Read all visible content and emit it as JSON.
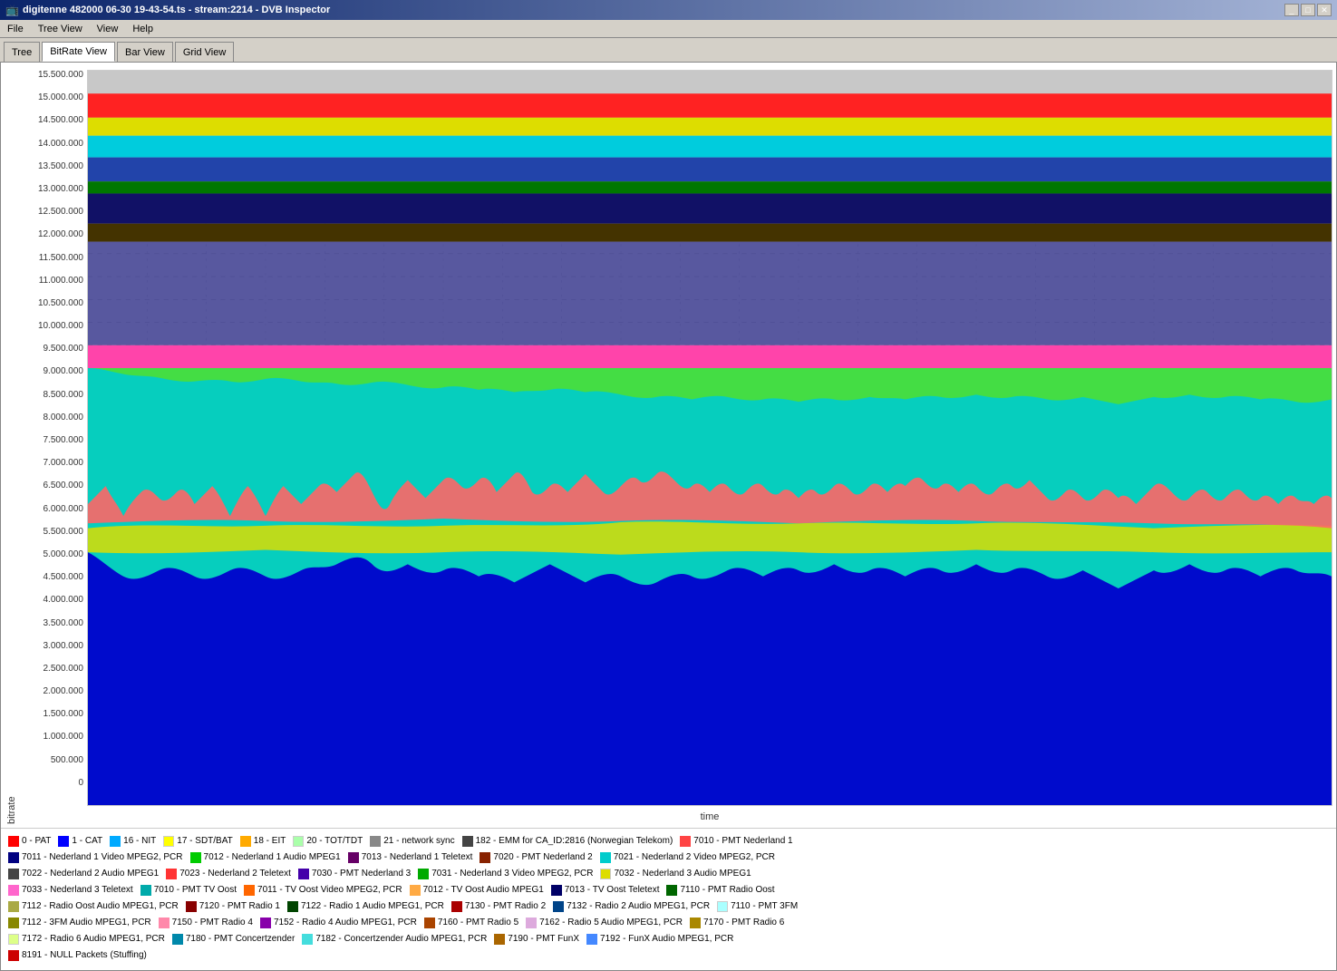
{
  "titleBar": {
    "title": "digitenne 482000 06-30 19-43-54.ts - stream:2214 - DVB Inspector",
    "icon": "dvb-icon",
    "controls": [
      "minimize",
      "restore",
      "close"
    ]
  },
  "menuBar": {
    "items": [
      "File",
      "Tree View",
      "View",
      "Help"
    ]
  },
  "tabs": [
    {
      "label": "Tree",
      "active": false
    },
    {
      "label": "BitRate View",
      "active": true
    },
    {
      "label": "Bar View",
      "active": false
    },
    {
      "label": "Grid View",
      "active": false
    }
  ],
  "chart": {
    "yAxisLabel": "bitrate",
    "xAxisLabel": "time",
    "yAxisValues": [
      "15.500.000",
      "15.000.000",
      "14.500.000",
      "14.000.000",
      "13.500.000",
      "13.000.000",
      "12.500.000",
      "12.000.000",
      "11.500.000",
      "11.000.000",
      "10.500.000",
      "10.000.000",
      "9.500.000",
      "9.000.000",
      "8.500.000",
      "8.000.000",
      "7.500.000",
      "7.000.000",
      "6.500.000",
      "6.000.000",
      "5.500.000",
      "5.000.000",
      "4.500.000",
      "4.000.000",
      "3.500.000",
      "3.000.000",
      "2.500.000",
      "2.000.000",
      "1.500.000",
      "1.000.000",
      "500.000",
      "0"
    ]
  },
  "legend": {
    "rows": [
      [
        {
          "color": "#FF0000",
          "label": "0 - PAT"
        },
        {
          "color": "#0000FF",
          "label": "1 - CAT"
        },
        {
          "color": "#00AAFF",
          "label": "16 - NIT"
        },
        {
          "color": "#FFFF00",
          "label": "17 - SDT/BAT"
        },
        {
          "color": "#FFAA00",
          "label": "18 - EIT"
        },
        {
          "color": "#AAFFAA",
          "label": "20 - TOT/TDT"
        },
        {
          "color": "#888888",
          "label": "21 - network sync"
        },
        {
          "color": "#555555",
          "label": "182 - EMM for CA_ID:2816 (Norwegian Telekom)"
        },
        {
          "color": "#FF4444",
          "label": "7010 - PMT Nederland 1"
        }
      ],
      [
        {
          "color": "#000080",
          "label": "7011 - Nederland 1 Video MPEG2, PCR"
        },
        {
          "color": "#00CC00",
          "label": "7012 - Nederland 1 Audio MPEG1"
        },
        {
          "color": "#660066",
          "label": "7013 - Nederland 1 Teletext"
        },
        {
          "color": "#882200",
          "label": "7020 - PMT Nederland 2"
        },
        {
          "color": "#00CCCC",
          "label": "7021 - Nederland 2 Video MPEG2, PCR"
        }
      ],
      [
        {
          "color": "#444444",
          "label": "7022 - Nederland 2 Audio MPEG1"
        },
        {
          "color": "#FF3333",
          "label": "7023 - Nederland 2 Teletext"
        },
        {
          "color": "#4400AA",
          "label": "7030 - PMT Nederland 3"
        },
        {
          "color": "#00AA00",
          "label": "7031 - Nederland 3 Video MPEG2, PCR"
        },
        {
          "color": "#DDDD00",
          "label": "7032 - Nederland 3 Audio MPEG1"
        }
      ],
      [
        {
          "color": "#FF66CC",
          "label": "7033 - Nederland 3 Teletext"
        },
        {
          "color": "#00AAAA",
          "label": "7010 - PMT TV Oost"
        },
        {
          "color": "#FF6600",
          "label": "7011 - TV Oost Video MPEG2, PCR"
        },
        {
          "color": "#FFAA44",
          "label": "7012 - TV Oost Audio MPEG1"
        },
        {
          "color": "#000066",
          "label": "7013 - TV Oost Teletext"
        },
        {
          "color": "#006600",
          "label": "7110 - PMT Radio Oost"
        }
      ],
      [
        {
          "color": "#AAAA44",
          "label": "7112 - Radio Oost Audio MPEG1, PCR"
        },
        {
          "color": "#880000",
          "label": "7120 - PMT Radio 1"
        },
        {
          "color": "#004400",
          "label": "7122 - Radio 1 Audio MPEG1, PCR"
        },
        {
          "color": "#AA0000",
          "label": "7130 - PMT Radio 2"
        },
        {
          "color": "#004488",
          "label": "7132 - Radio 2 Audio MPEG1, PCR"
        },
        {
          "color": "#AAFFFF",
          "label": "7110 - PMT 3FM"
        }
      ],
      [
        {
          "color": "#888800",
          "label": "7112 - 3FM Audio MPEG1, PCR"
        },
        {
          "color": "#FF88AA",
          "label": "7150 - PMT Radio 4"
        },
        {
          "color": "#8800AA",
          "label": "7152 - Radio 4 Audio MPEG1, PCR"
        },
        {
          "color": "#AA4400",
          "label": "7160 - PMT Radio 5"
        },
        {
          "color": "#DDAADD",
          "label": "7162 - Radio 5 Audio MPEG1, PCR"
        },
        {
          "color": "#AA8800",
          "label": "7170 - PMT Radio 6"
        }
      ],
      [
        {
          "color": "#DDFF88",
          "label": "7172 - Radio 6 Audio MPEG1, PCR"
        },
        {
          "color": "#0088AA",
          "label": "7180 - PMT Concertzender"
        },
        {
          "color": "#44DDDD",
          "label": "7182 - Concertzender Audio MPEG1, PCR"
        },
        {
          "color": "#AA6600",
          "label": "7190 - PMT FunX"
        },
        {
          "color": "#4488FF",
          "label": "7192 - FunX Audio MPEG1, PCR"
        }
      ],
      [
        {
          "color": "#CC0000",
          "label": "8191 - NULL Packets (Stuffing)"
        }
      ]
    ]
  }
}
